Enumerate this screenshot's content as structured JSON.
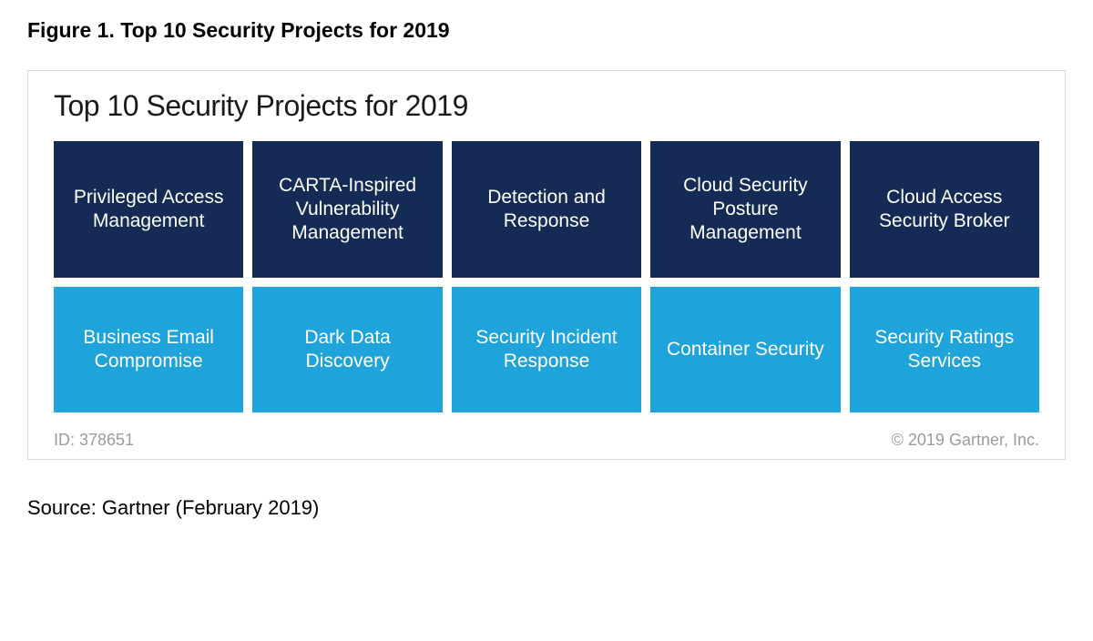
{
  "figure_caption": "Figure 1. Top 10 Security Projects for 2019",
  "chart": {
    "title": "Top 10 Security Projects for 2019",
    "top_row": [
      "Privileged Access Management",
      "CARTA-Inspired Vulnerability Management",
      "Detection and Response",
      "Cloud Security Posture Management",
      "Cloud Access Security Broker"
    ],
    "bottom_row": [
      "Business Email Compromise",
      "Dark Data Discovery",
      "Security Incident Response",
      "Container Security",
      "Security Ratings Services"
    ],
    "id_label": "ID: 378651",
    "copyright": "© 2019 Gartner, Inc."
  },
  "source": "Source: Gartner (February 2019)",
  "colors": {
    "dark_tile": "#132b55",
    "light_tile": "#1fa3db"
  }
}
